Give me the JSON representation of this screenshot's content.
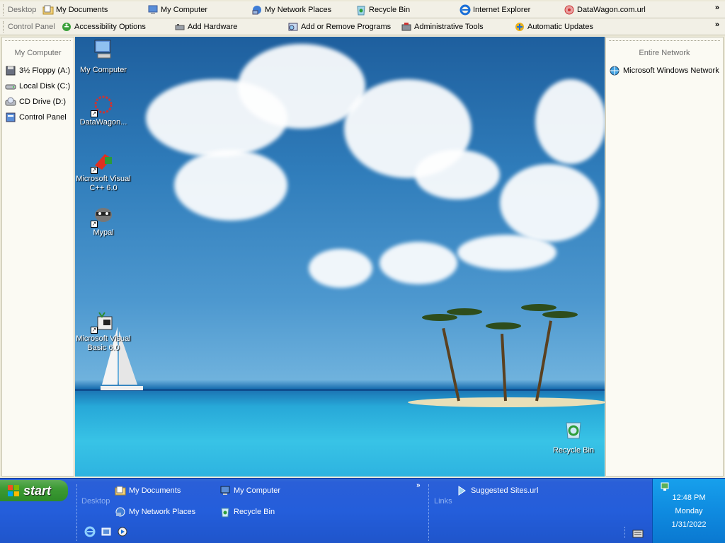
{
  "toolbar_desktop": {
    "label": "Desktop",
    "items": [
      {
        "label": "My Documents",
        "icon": "folder-documents-icon"
      },
      {
        "label": "My Computer",
        "icon": "computer-icon"
      },
      {
        "label": "My Network Places",
        "icon": "network-icon"
      },
      {
        "label": "Recycle Bin",
        "icon": "recycle-bin-icon"
      },
      {
        "label": "Internet Explorer",
        "icon": "ie-icon"
      },
      {
        "label": "DataWagon.com.url",
        "icon": "url-icon"
      }
    ],
    "more": "»"
  },
  "toolbar_control_panel": {
    "label": "Control Panel",
    "items": [
      {
        "label": "Accessibility Options",
        "icon": "accessibility-icon"
      },
      {
        "label": "Add Hardware",
        "icon": "hardware-icon"
      },
      {
        "label": "Add or Remove Programs",
        "icon": "programs-icon"
      },
      {
        "label": "Administrative Tools",
        "icon": "admin-tools-icon"
      },
      {
        "label": "Automatic Updates",
        "icon": "updates-icon"
      }
    ],
    "more": "»"
  },
  "left_panel": {
    "title": "My Computer",
    "items": [
      {
        "label": "3½ Floppy (A:)",
        "icon": "floppy-icon"
      },
      {
        "label": "Local Disk (C:)",
        "icon": "disk-icon"
      },
      {
        "label": "CD Drive (D:)",
        "icon": "cd-drive-icon"
      },
      {
        "label": "Control Panel",
        "icon": "control-panel-icon"
      }
    ]
  },
  "right_panel": {
    "title": "Entire Network",
    "items": [
      {
        "label": "Microsoft Windows Network",
        "icon": "windows-network-icon"
      }
    ]
  },
  "desktop_icons": [
    {
      "label": "My Computer",
      "icon": "computer-icon"
    },
    {
      "label": "DataWagon...",
      "icon": "datawagon-icon"
    },
    {
      "label": "Microsoft Visual C++ 6.0",
      "icon": "visual-cpp-icon"
    },
    {
      "label": "Mypal",
      "icon": "mypal-icon"
    },
    {
      "label": "Microsoft Visual Basic 6.0",
      "icon": "visual-basic-icon"
    },
    {
      "label": "Recycle Bin",
      "icon": "recycle-bin-icon"
    }
  ],
  "taskbar": {
    "start_label": "start",
    "desktop_label": "Desktop",
    "desktop_items": [
      {
        "label": "My Documents",
        "icon": "folder-documents-icon"
      },
      {
        "label": "My Computer",
        "icon": "computer-icon"
      },
      {
        "label": "My Network Places",
        "icon": "network-icon"
      },
      {
        "label": "Recycle Bin",
        "icon": "recycle-bin-icon"
      }
    ],
    "links_label": "Links",
    "links_items": [
      {
        "label": "Suggested Sites.url",
        "icon": "url-icon"
      }
    ],
    "more": "»",
    "clock": {
      "time": "12:48 PM",
      "day": "Monday",
      "date": "1/31/2022"
    }
  }
}
